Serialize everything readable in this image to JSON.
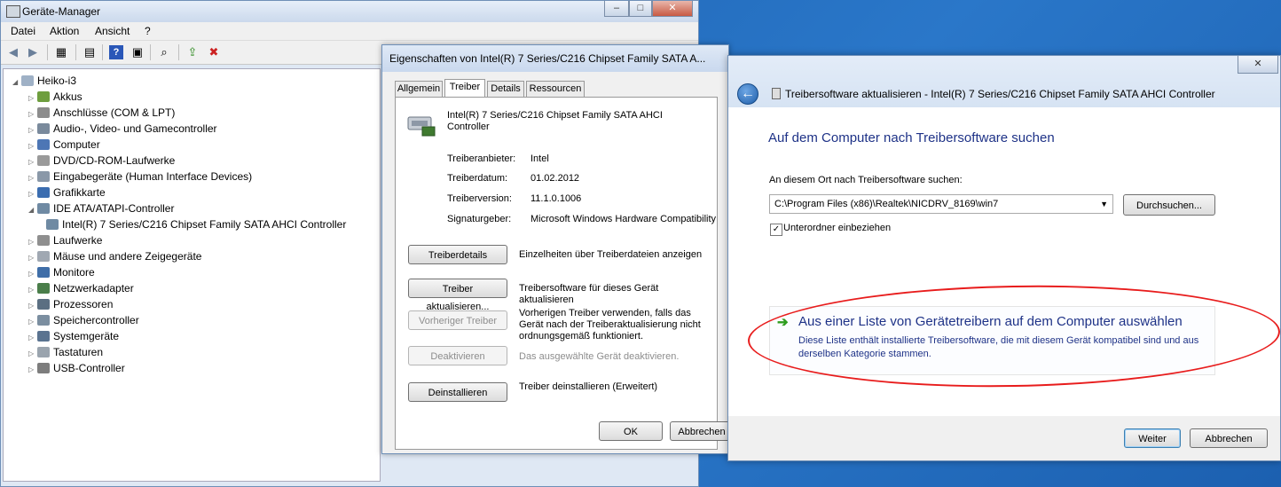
{
  "device_manager": {
    "title": "Geräte-Manager",
    "window_controls": [
      "–",
      "□",
      "✕"
    ],
    "menu": [
      "Datei",
      "Aktion",
      "Ansicht",
      "?"
    ],
    "tree": {
      "root": "Heiko-i3",
      "items": [
        {
          "label": "Akkus",
          "icon": "battery-icon"
        },
        {
          "label": "Anschlüsse (COM & LPT)",
          "icon": "port-icon"
        },
        {
          "label": "Audio-, Video- und Gamecontroller",
          "icon": "speaker-icon"
        },
        {
          "label": "Computer",
          "icon": "computer-icon"
        },
        {
          "label": "DVD/CD-ROM-Laufwerke",
          "icon": "dvd-drive-icon"
        },
        {
          "label": "Eingabegeräte (Human Interface Devices)",
          "icon": "hid-icon"
        },
        {
          "label": "Grafikkarte",
          "icon": "display-adapter-icon"
        },
        {
          "label": "IDE ATA/ATAPI-Controller",
          "icon": "ide-controller-icon"
        },
        {
          "label": "Intel(R) 7 Series/C216 Chipset Family SATA AHCI Controller",
          "icon": "sata-controller-icon"
        },
        {
          "label": "Laufwerke",
          "icon": "disk-drive-icon"
        },
        {
          "label": "Mäuse und andere Zeigegeräte",
          "icon": "mouse-icon"
        },
        {
          "label": "Monitore",
          "icon": "monitor-icon"
        },
        {
          "label": "Netzwerkadapter",
          "icon": "network-adapter-icon"
        },
        {
          "label": "Prozessoren",
          "icon": "processor-icon"
        },
        {
          "label": "Speichercontroller",
          "icon": "storage-controller-icon"
        },
        {
          "label": "Systemgeräte",
          "icon": "system-device-icon"
        },
        {
          "label": "Tastaturen",
          "icon": "keyboard-icon"
        },
        {
          "label": "USB-Controller",
          "icon": "usb-icon"
        }
      ]
    }
  },
  "properties": {
    "title": "Eigenschaften von Intel(R) 7 Series/C216 Chipset Family SATA A...",
    "tabs": [
      "Allgemein",
      "Treiber",
      "Details",
      "Ressourcen"
    ],
    "active_tab": "Treiber",
    "device_name": "Intel(R) 7 Series/C216 Chipset Family SATA AHCI Controller",
    "fields": [
      {
        "label": "Treiberanbieter:",
        "value": "Intel"
      },
      {
        "label": "Treiberdatum:",
        "value": "01.02.2012"
      },
      {
        "label": "Treiberversion:",
        "value": "11.1.0.1006"
      },
      {
        "label": "Signaturgeber:",
        "value": "Microsoft Windows Hardware Compatibility"
      }
    ],
    "actions": [
      {
        "button": "Treiberdetails",
        "desc": "Einzelheiten über Treiberdateien anzeigen",
        "enabled": true
      },
      {
        "button": "Treiber aktualisieren...",
        "desc": "Treibersoftware für dieses Gerät aktualisieren",
        "enabled": true
      },
      {
        "button": "Vorheriger Treiber",
        "desc": "Vorherigen Treiber verwenden, falls das Gerät nach der Treiberaktualisierung nicht ordnungsgemäß funktioniert.",
        "enabled": false
      },
      {
        "button": "Deaktivieren",
        "desc": "Das ausgewählte Gerät deaktivieren.",
        "enabled": false
      },
      {
        "button": "Deinstallieren",
        "desc": "Treiber deinstallieren (Erweitert)",
        "enabled": true
      }
    ],
    "ok": "OK",
    "cancel": "Abbrechen"
  },
  "wizard": {
    "title": "Treibersoftware aktualisieren - Intel(R) 7 Series/C216 Chipset Family SATA AHCI Controller",
    "heading": "Auf dem Computer nach Treibersoftware suchen",
    "location_label": "An diesem Ort nach Treibersoftware suchen:",
    "path_value": "C:\\Program Files (x86)\\Realtek\\NICDRV_8169\\win7",
    "browse": "Durchsuchen...",
    "include_subfolders": "Unterordner einbeziehen",
    "include_subfolders_checked": true,
    "pick_title": "Aus einer Liste von Gerätetreibern auf dem Computer auswählen",
    "pick_desc": "Diese Liste enthält installierte Treibersoftware, die mit diesem Gerät kompatibel sind und aus derselben Kategorie stammen.",
    "next": "Weiter",
    "cancel": "Abbrechen",
    "close": "✕"
  },
  "colors": {
    "link_blue": "#1e3287",
    "annotation_red": "#e81c1c",
    "desktop_blue": "#1e5fae"
  }
}
